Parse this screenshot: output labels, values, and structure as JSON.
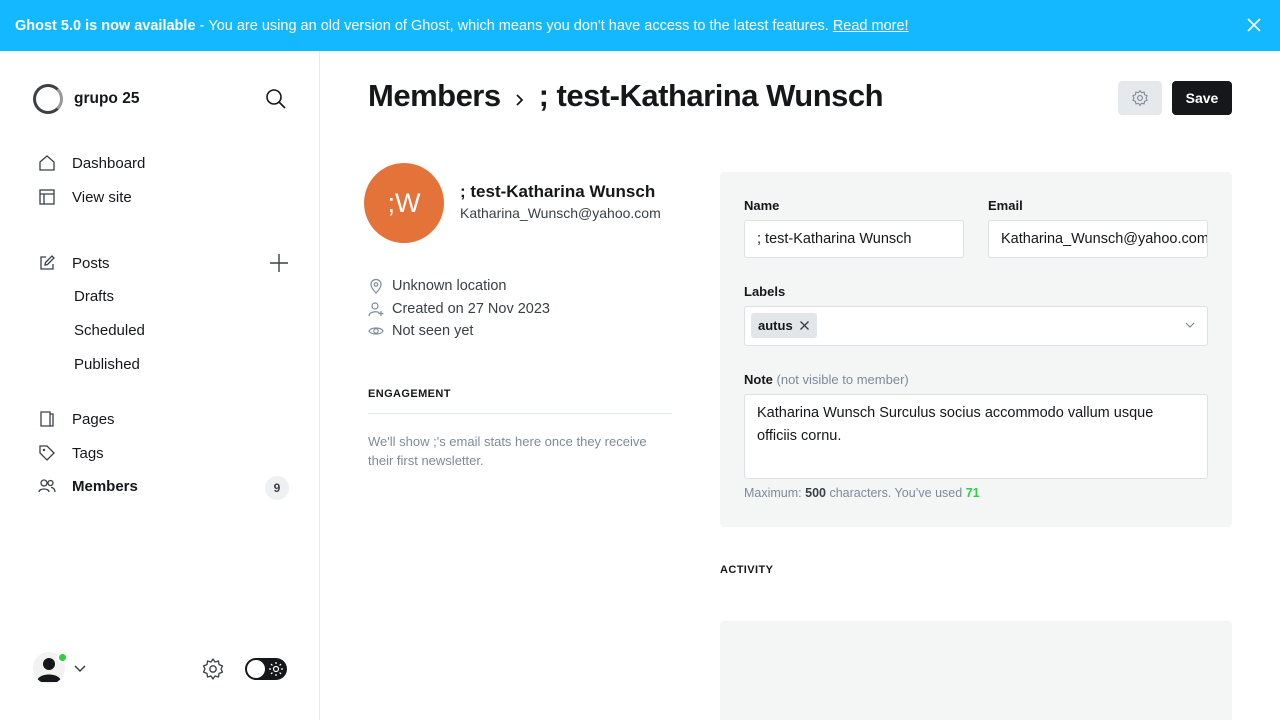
{
  "banner": {
    "title": "Ghost 5.0 is now available",
    "separator": "-",
    "message": "You are using an old version of Ghost, which means you don't have access to the latest features.",
    "link": "Read more!"
  },
  "sidebar": {
    "site_name": "grupo 25",
    "items": [
      {
        "label": "Dashboard",
        "icon": "home-icon"
      },
      {
        "label": "View site",
        "icon": "layout-icon"
      },
      {
        "label": "Posts",
        "icon": "edit-icon"
      },
      {
        "label": "Drafts"
      },
      {
        "label": "Scheduled"
      },
      {
        "label": "Published"
      },
      {
        "label": "Pages",
        "icon": "pages-icon"
      },
      {
        "label": "Tags",
        "icon": "tag-icon"
      },
      {
        "label": "Members",
        "icon": "members-icon",
        "count": "9"
      }
    ]
  },
  "header": {
    "section": "Members",
    "member": "; test-Katharina Wunsch",
    "save_label": "Save"
  },
  "member": {
    "initials": ";W",
    "name": "; test-Katharina Wunsch",
    "email": "Katharina_Wunsch@yahoo.com",
    "location": "Unknown location",
    "created": "Created on 27 Nov 2023",
    "seen": "Not seen yet",
    "avatar_color": "#e4733a"
  },
  "engagement": {
    "title": "ENGAGEMENT",
    "text": "We'll show ;'s email stats here once they receive their first newsletter."
  },
  "form": {
    "name_label": "Name",
    "name_value": ";   test-Katharina Wunsch",
    "email_label": "Email",
    "email_value": "Katharina_Wunsch@yahoo.com",
    "labels_label": "Labels",
    "labels": [
      "autus"
    ],
    "note_label": "Note",
    "note_hint": "(not visible to member)",
    "note_value": "Katharina Wunsch Surculus socius accommodo vallum usque officiis cornu.",
    "max_prefix": "Maximum:",
    "max_value": "500",
    "max_mid": "characters. You’ve used",
    "used_value": "71"
  },
  "activity": {
    "title": "ACTIVITY"
  },
  "colors": {
    "banner": "#14b8ff",
    "primary": "#15171a",
    "green": "#30cf43"
  }
}
